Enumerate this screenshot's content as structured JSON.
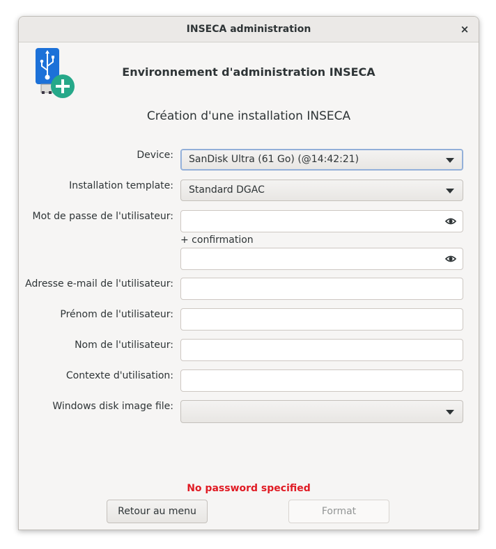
{
  "window": {
    "title": "INSECA administration",
    "close_glyph": "×"
  },
  "header": {
    "title": "Environnement d'administration INSECA",
    "logo_icon": "usb-add-icon"
  },
  "subtitle": "Création d'une installation INSECA",
  "form": {
    "device": {
      "label": "Device:",
      "value": "SanDisk Ultra (61 Go) (@14:42:21)"
    },
    "template": {
      "label": "Installation template:",
      "value": "Standard DGAC"
    },
    "password": {
      "label": "Mot de passe de l'utilisateur:",
      "value": "",
      "confirm_label": "+ confirmation",
      "confirm_value": ""
    },
    "email": {
      "label": "Adresse e-mail de l'utilisateur:",
      "value": ""
    },
    "firstname": {
      "label": "Prénom de l'utilisateur:",
      "value": ""
    },
    "lastname": {
      "label": "Nom de l'utilisateur:",
      "value": ""
    },
    "context": {
      "label": "Contexte d'utilisation:",
      "value": ""
    },
    "windows_image": {
      "label": "Windows disk image file:",
      "value": ""
    }
  },
  "status": {
    "error": "No password specified",
    "error_color": "#e01b24"
  },
  "buttons": {
    "back": "Retour au menu",
    "format": "Format"
  },
  "colors": {
    "logo_blue": "#1c71d8",
    "logo_green": "#26a889"
  }
}
